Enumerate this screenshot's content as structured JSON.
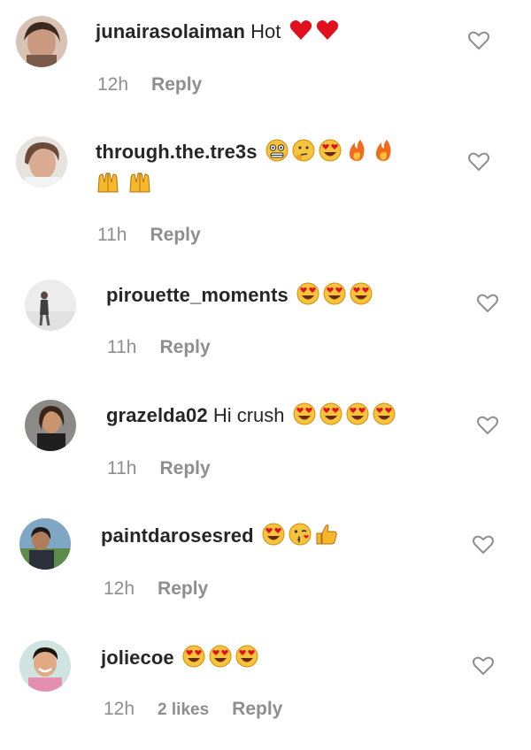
{
  "comments": [
    {
      "username": "junairasolaiman",
      "text": " Hot",
      "emoji": [
        "red-heart",
        "red-heart"
      ],
      "emoji2": [],
      "time": "12h",
      "likes": "",
      "reply": "Reply"
    },
    {
      "username": "through.the.tre3s",
      "text": " ",
      "emoji": [
        "grimace-face",
        "thinking-face",
        "heart-eyes-face",
        "fire",
        "fire"
      ],
      "emoji2": [
        "raising-hands",
        "raising-hands"
      ],
      "time": "11h",
      "likes": "",
      "reply": "Reply"
    },
    {
      "username": "pirouette_moments",
      "text": " ",
      "emoji": [
        "heart-eyes-face",
        "heart-eyes-face",
        "heart-eyes-face"
      ],
      "emoji2": [],
      "time": "11h",
      "likes": "",
      "reply": "Reply"
    },
    {
      "username": "grazelda02",
      "text": " Hi crush",
      "emoji": [
        "heart-eyes-face",
        "heart-eyes-face",
        "heart-eyes-face",
        "heart-eyes-face"
      ],
      "emoji2": [],
      "time": "11h",
      "likes": "",
      "reply": "Reply"
    },
    {
      "username": "paintdarosesred",
      "text": " ",
      "emoji": [
        "heart-eyes-face",
        "kissing-face",
        "thumbs-up"
      ],
      "emoji2": [],
      "time": "12h",
      "likes": "",
      "reply": "Reply"
    },
    {
      "username": "joliecoe",
      "text": " ",
      "emoji": [
        "heart-eyes-face",
        "heart-eyes-face",
        "heart-eyes-face"
      ],
      "emoji2": [],
      "time": "12h",
      "likes": "2 likes",
      "reply": "Reply"
    }
  ],
  "colors": {
    "username": "#262626",
    "meta": "#8e8e8e",
    "heart_outline": "#8e8e8e"
  }
}
